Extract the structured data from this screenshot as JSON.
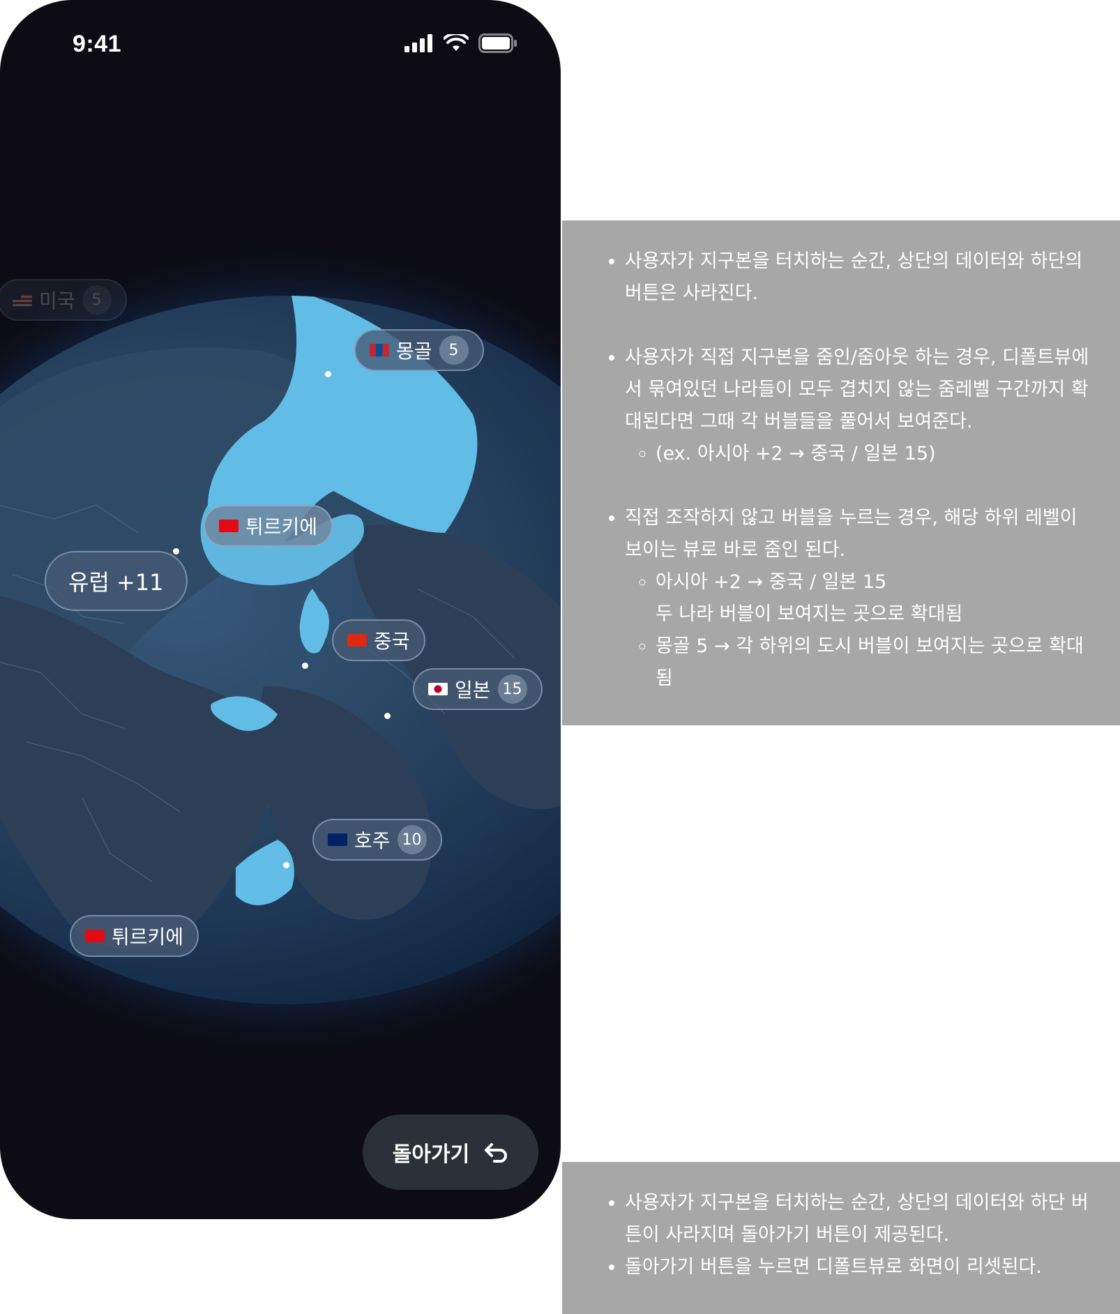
{
  "status_bar": {
    "time": "9:41"
  },
  "bubbles": {
    "usa": {
      "flag": "us-flag",
      "label": "미국",
      "count": "5"
    },
    "mongolia": {
      "flag": "mongolia-flag",
      "label": "몽골",
      "count": "5"
    },
    "turkey_top": {
      "flag": "turkey-flag",
      "label": "튀르키에"
    },
    "europe": {
      "label": "유럽 +11"
    },
    "china": {
      "flag": "china-flag",
      "label": "중국"
    },
    "japan": {
      "flag": "japan-flag",
      "label": "일본",
      "count": "15"
    },
    "australia": {
      "flag": "australia-flag",
      "label": "호주",
      "count": "10"
    },
    "turkey_bottom": {
      "flag": "turkey-flag",
      "label": "튀르키에"
    }
  },
  "back_button": {
    "label": "돌아가기",
    "icon": "return-arrow-icon"
  },
  "colors": {
    "highlight": "#62bde6",
    "bubble": "#465a73",
    "note_bg": "#a7a7a7"
  },
  "notes_top": {
    "items": [
      "사용자가 지구본을 터치하는 순간, 상단의 데이터와 하단의 버튼은 사라진다.",
      "사용자가 직접 지구본을 줌인/줌아웃 하는 경우, 디폴트뷰에서 묶여있던 나라들이 모두 겹치지 않는 줌레벨 구간까지 확대된다면 그때 각 버블들을 풀어서 보여준다.",
      "(ex. 아시아 +2 → 중국 / 일본 15)",
      "직접 조작하지 않고 버블을 누르는 경우, 해당 하위 레벨이 보이는 뷰로 바로 줌인 된다.",
      "아시아 +2 → 중국 / 일본 15",
      "두 나라 버블이 보여지는 곳으로 확대됨",
      "몽골 5 → 각 하위의 도시 버블이 보여지는 곳으로 확대됨"
    ]
  },
  "notes_bottom": {
    "items": [
      "사용자가 지구본을 터치하는 순간, 상단의 데이터와 하단 버튼이 사라지며 돌아가기 버튼이 제공된다.",
      "돌아가기 버튼을 누르면 디폴트뷰로 화면이 리셋된다."
    ]
  }
}
